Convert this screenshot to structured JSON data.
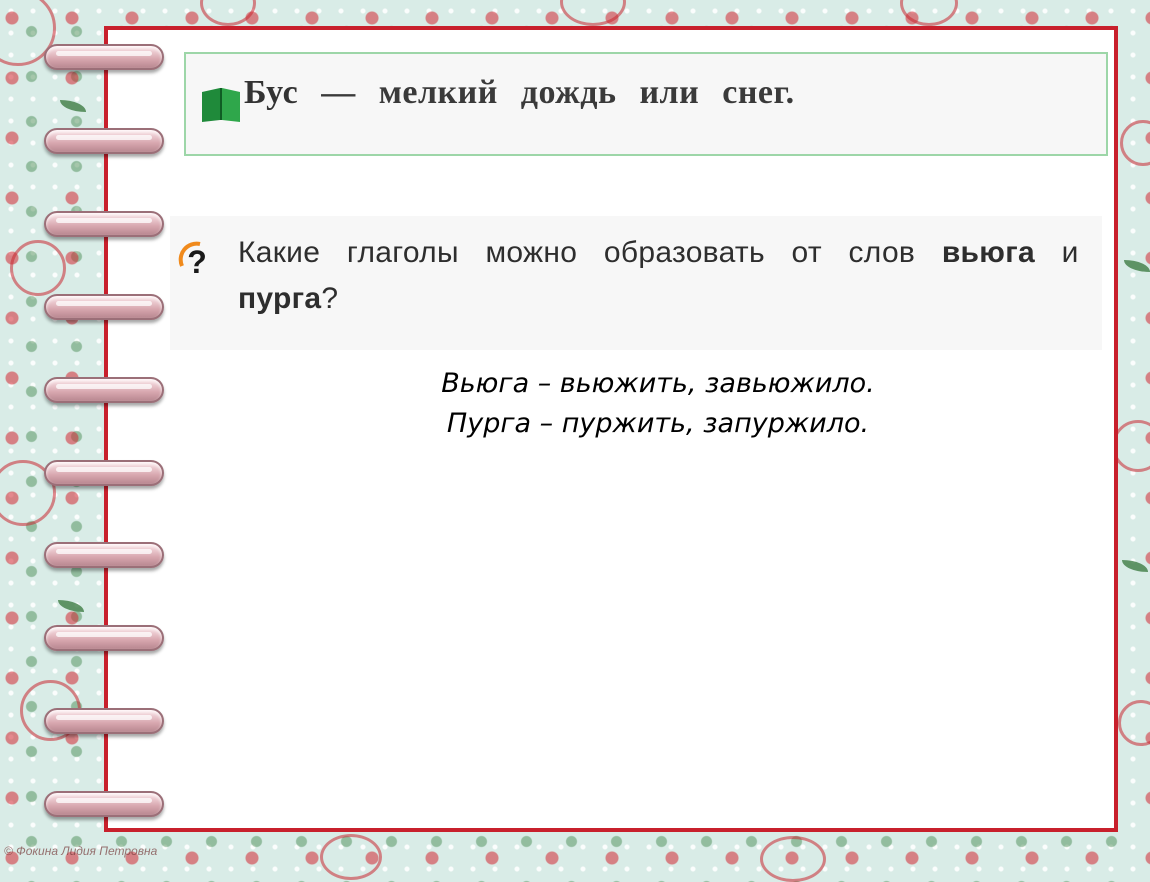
{
  "definition": {
    "term": "Бус",
    "dash": "—",
    "meaning": "мелкий дождь или снег."
  },
  "question": {
    "text_before": "Какие глаголы можно образовать от слов ",
    "word1": "вьюга",
    "conj": " и ",
    "word2": "пурга",
    "end": "?"
  },
  "answers": [
    "Вьюга – вьюжить, завьюжило.",
    "Пурга – пуржить, запуржило."
  ],
  "icons": {
    "definition": "book-icon",
    "question": "question-mark-icon"
  },
  "footer": {
    "copyright": "© Фокина Лидия Петровна"
  },
  "colors": {
    "frame": "#c8202c",
    "def_border": "#9dd6a8",
    "background": "#d9ece7"
  }
}
